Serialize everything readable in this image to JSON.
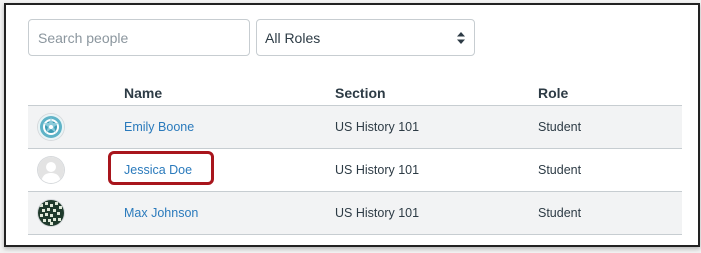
{
  "search": {
    "placeholder": "Search people",
    "value": ""
  },
  "role_filter": {
    "selected": "All Roles"
  },
  "table": {
    "headers": [
      "Name",
      "Section",
      "Role"
    ],
    "rows": [
      {
        "name": "Emily Boone",
        "section": "US History 101",
        "role": "Student",
        "avatar": "teal-pattern-avatar"
      },
      {
        "name": "Jessica Doe",
        "section": "US History 101",
        "role": "Student",
        "avatar": "default-person-avatar"
      },
      {
        "name": "Max Johnson",
        "section": "US History 101",
        "role": "Student",
        "avatar": "green-pattern-avatar"
      }
    ]
  },
  "colors": {
    "link": "#2a7abc",
    "highlight": "#a8151c",
    "alt_row": "#f2f3f4"
  }
}
